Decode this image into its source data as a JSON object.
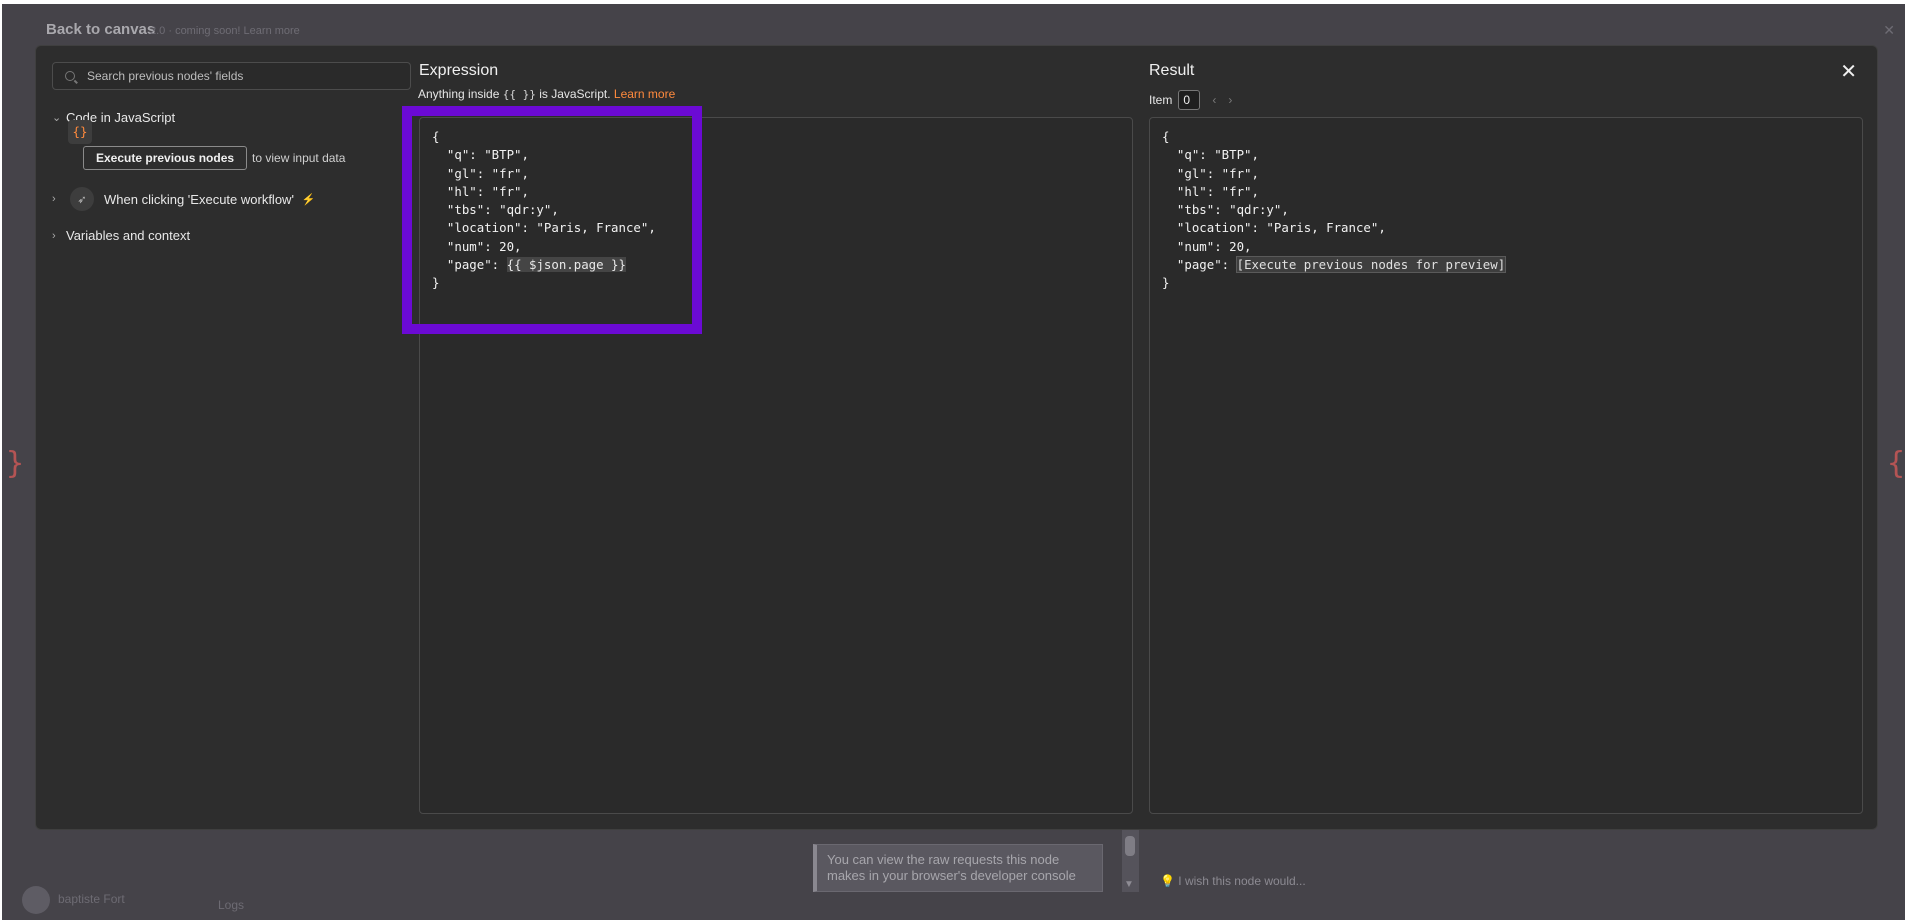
{
  "background": {
    "back_label": "Back to canvas",
    "back_sub": "2.0 · coming soon! Learn more",
    "tip_text": "You can view the raw requests this node makes in your browser's developer console",
    "wish_text": "I wish this node would...",
    "user_name": "baptiste Fort",
    "logs_label": "Logs"
  },
  "search": {
    "placeholder": "Search previous nodes' fields"
  },
  "tree": {
    "node1": {
      "label": "Code in JavaScript",
      "icon": "code-braces-icon"
    },
    "exec_button": "Execute previous nodes",
    "exec_hint": "to view input data",
    "node2": {
      "label": "When clicking 'Execute workflow'",
      "icon": "cursor-icon"
    },
    "node3": {
      "label": "Variables and context"
    }
  },
  "expression": {
    "title": "Expression",
    "sub_prefix": "Anything inside",
    "sub_code": "{{ }}",
    "sub_suffix": "is JavaScript.",
    "learn_more": "Learn more",
    "lines": [
      "{",
      "  \"q\": \"BTP\",",
      "  \"gl\": \"fr\",",
      "  \"hl\": \"fr\",",
      "  \"tbs\": \"qdr:y\",",
      "  \"location\": \"Paris, France\",",
      "  \"num\": 20,"
    ],
    "page_prefix": "  \"page\": ",
    "page_expr": "{{ $json.page }}",
    "closing": "}"
  },
  "result": {
    "title": "Result",
    "item_label": "Item",
    "item_value": "0",
    "lines": [
      "{",
      "  \"q\": \"BTP\",",
      "  \"gl\": \"fr\",",
      "  \"hl\": \"fr\",",
      "  \"tbs\": \"qdr:y\",",
      "  \"location\": \"Paris, France\",",
      "  \"num\": 20,"
    ],
    "page_prefix": "  \"page\": ",
    "page_value": "[Execute previous nodes for preview]",
    "closing": "}"
  },
  "colors": {
    "accent": "#ff8a3d",
    "highlight": "#6b0ad4",
    "panel": "#2d2d2d"
  }
}
